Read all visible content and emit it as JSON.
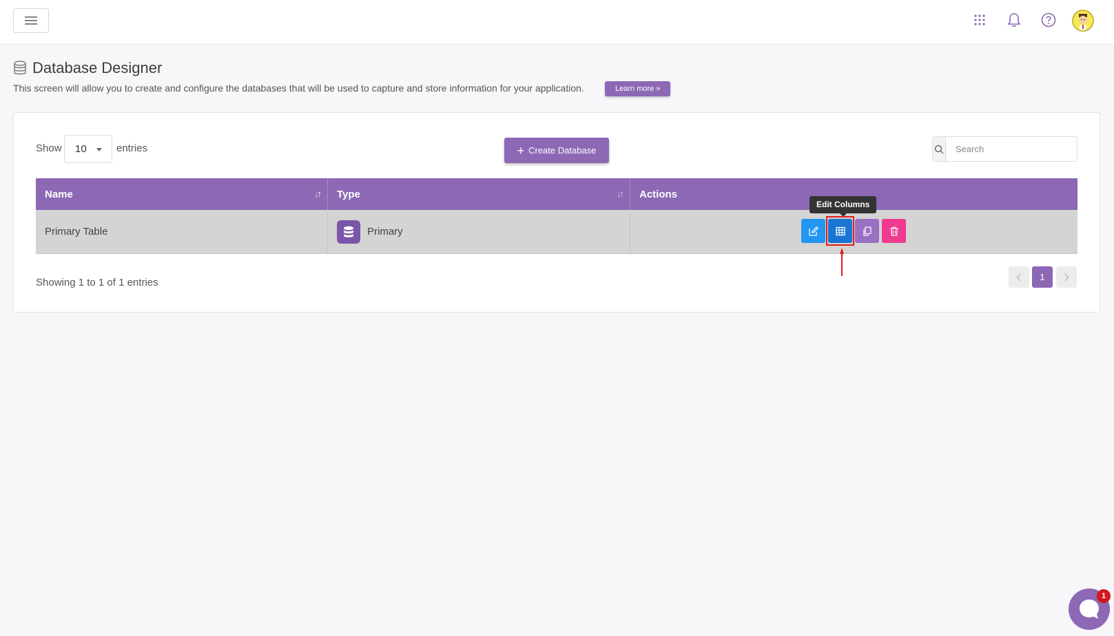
{
  "header": {
    "menu_icon": "hamburger-icon",
    "icons": [
      "apps-grid-icon",
      "bell-icon",
      "help-circle-icon"
    ],
    "avatar_icon": "user-avatar"
  },
  "page": {
    "title": "Database Designer",
    "title_icon": "database-icon",
    "description": "This screen will allow you to create and configure the databases that will be used to capture and store information for your application.",
    "learn_more_label": "Learn more »"
  },
  "controls": {
    "show_label": "Show",
    "entries_value": "10",
    "entries_label": "entries",
    "create_label": "Create Database",
    "search_placeholder": "Search"
  },
  "table": {
    "columns": [
      "Name",
      "Type",
      "Actions"
    ],
    "rows": [
      {
        "name": "Primary Table",
        "type": "Primary"
      }
    ]
  },
  "actions": {
    "tooltip": "Edit Columns",
    "buttons": [
      {
        "name": "edit",
        "icon": "edit-icon",
        "color": "#2196f3"
      },
      {
        "name": "edit-columns",
        "icon": "grid-table-icon",
        "color": "#1976d2"
      },
      {
        "name": "copy",
        "icon": "copy-icon",
        "color": "#9a70c4"
      },
      {
        "name": "delete",
        "icon": "trash-icon",
        "color": "#ef3b8e"
      }
    ]
  },
  "footer": {
    "showing": "Showing 1 to 1 of 1 entries",
    "current_page": "1"
  },
  "chat": {
    "badge": "1"
  },
  "colors": {
    "accent": "#8c68b5",
    "highlight": "#e01b1b"
  }
}
